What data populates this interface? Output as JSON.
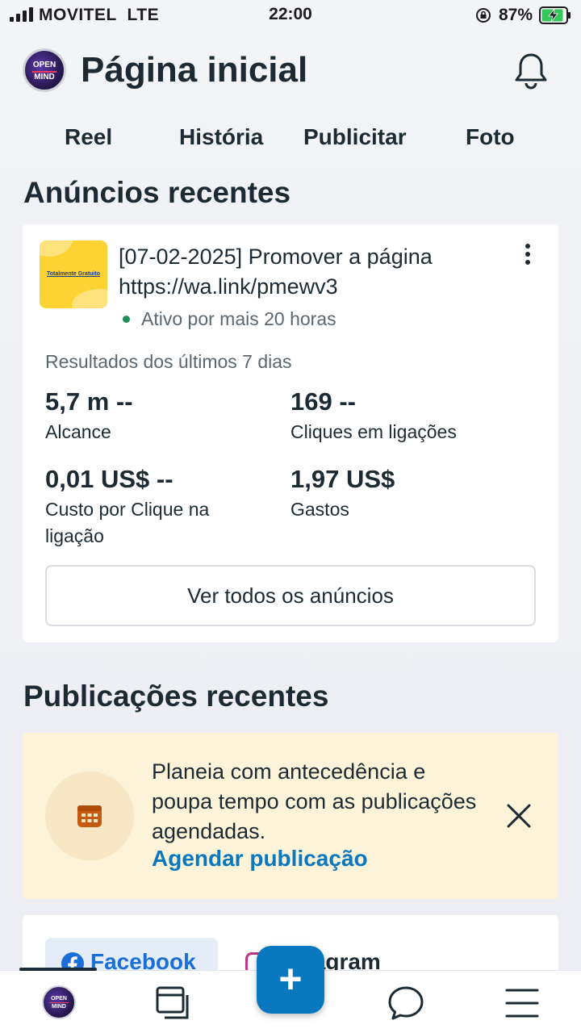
{
  "status_bar": {
    "carrier": "MOVITEL",
    "network": "LTE",
    "time": "22:00",
    "battery": "87%"
  },
  "header": {
    "avatar_text_top": "OPEN",
    "avatar_text_bottom": "MIND",
    "title": "Página inicial"
  },
  "quick_actions": [
    "Reel",
    "História",
    "Publicitar",
    "Foto"
  ],
  "ads_section": {
    "title": "Anúncios recentes",
    "ad": {
      "thumbnail_text": "Totalmente Gratuito",
      "title": "[07-02-2025] Promover a página https://wa.link/pmewv3",
      "status": "Ativo por mais 20 horas",
      "status_color": "#1e8e5a"
    },
    "results_label": "Resultados dos últimos 7 dias",
    "metrics": [
      {
        "value": "5,7 m --",
        "label": "Alcance"
      },
      {
        "value": "169 --",
        "label": "Cliques em ligações"
      },
      {
        "value": "0,01 US$ --",
        "label": "Custo por Clique na ligação"
      },
      {
        "value": "1,97 US$",
        "label": "Gastos"
      }
    ],
    "see_all": "Ver todos os anúncios"
  },
  "posts_section": {
    "title": "Publicações recentes",
    "tip": {
      "text": "Planeia com antecedência e poupa tempo com as publicações agendadas.",
      "link": "Agendar publicação"
    },
    "tabs": {
      "facebook": "Facebook",
      "instagram": "Instagram"
    }
  },
  "bottom_nav": {
    "fab": "+"
  },
  "colors": {
    "accent": "#0a78be",
    "facebook": "#1a6ed8",
    "tip_bg": "#fcf3d8",
    "text": "#1c2b33"
  },
  "icons": [
    "lock-rotation-icon",
    "battery-charging-icon",
    "bell-icon",
    "more-vertical-icon",
    "calendar-icon",
    "close-icon",
    "facebook-icon",
    "instagram-icon",
    "pages-icon",
    "plus-icon",
    "chat-bubble-icon",
    "menu-icon"
  ]
}
